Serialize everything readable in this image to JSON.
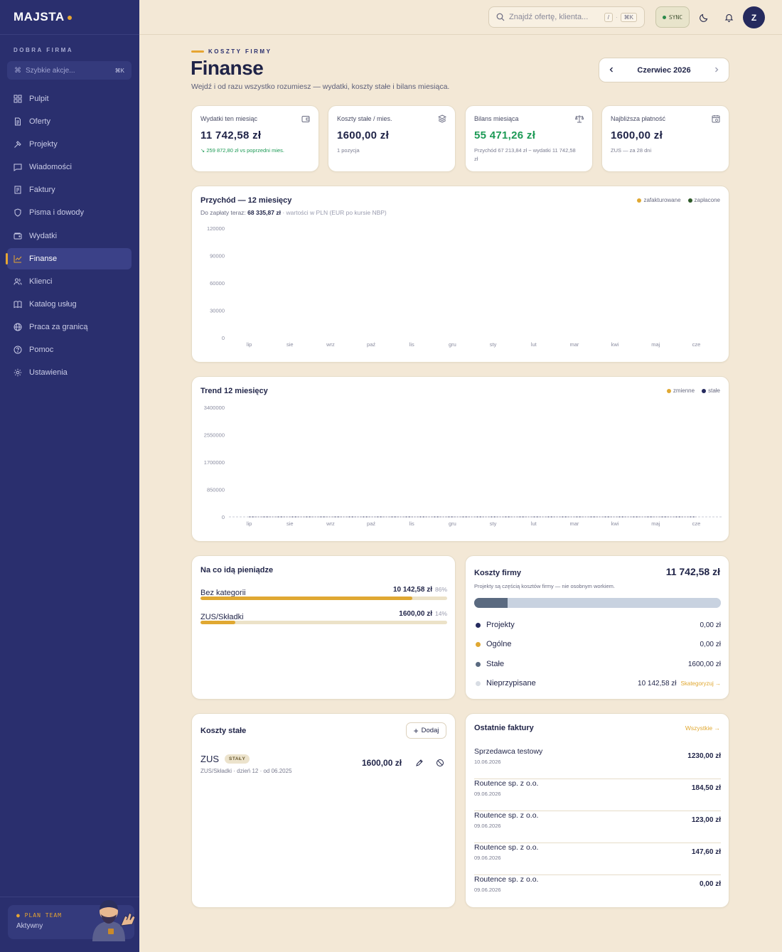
{
  "app": {
    "logo": "MAJSTA"
  },
  "sidebar": {
    "org_label": "DOBRA FIRMA",
    "quick_actions": {
      "label": "Szybkie akcje...",
      "shortcut": "⌘K"
    },
    "items": [
      {
        "label": "Pulpit",
        "icon": "dashboard-icon",
        "active": false
      },
      {
        "label": "Oferty",
        "icon": "document-icon",
        "active": false
      },
      {
        "label": "Projekty",
        "icon": "hammer-icon",
        "active": false
      },
      {
        "label": "Wiadomości",
        "icon": "message-icon",
        "active": false
      },
      {
        "label": "Faktury",
        "icon": "invoice-icon",
        "active": false
      },
      {
        "label": "Pisma i dowody",
        "icon": "shield-icon",
        "active": false
      },
      {
        "label": "Wydatki",
        "icon": "wallet-icon",
        "active": false
      },
      {
        "label": "Finanse",
        "icon": "chart-line-icon",
        "active": true
      },
      {
        "label": "Klienci",
        "icon": "users-icon",
        "active": false
      },
      {
        "label": "Katalog usług",
        "icon": "book-icon",
        "active": false
      },
      {
        "label": "Praca za granicą",
        "icon": "globe-icon",
        "active": false
      },
      {
        "label": "Pomoc",
        "icon": "help-icon",
        "active": false
      },
      {
        "label": "Ustawienia",
        "icon": "gear-icon",
        "active": false
      }
    ],
    "plan": {
      "title": "PLAN TEAM",
      "status": "Aktywny"
    }
  },
  "topbar": {
    "search_placeholder": "Znajdź ofertę, klienta...",
    "search_key1": "/",
    "search_sep": "·",
    "search_key2": "⌘K",
    "sync_label": "SYNC",
    "avatar_initial": "Z"
  },
  "header": {
    "eyebrow": "KOSZTY FIRMY",
    "title": "Finanse",
    "subtitle": "Wejdź i od razu wszystko rozumiesz — wydatki, koszty stałe i bilans miesiąca.",
    "month": "Czerwiec 2026"
  },
  "stats": [
    {
      "label": "Wydatki ten miesiąc",
      "value": "11 742,58 zł",
      "sub": "↘ 259 872,80 zł vs poprzedni mies.",
      "icon": "wallet-icon",
      "green_value": false,
      "green_sub": true
    },
    {
      "label": "Koszty stałe / mies.",
      "value": "1600,00 zł",
      "sub": "1 pozycja",
      "icon": "layers-icon",
      "green_value": false,
      "green_sub": false
    },
    {
      "label": "Bilans miesiąca",
      "value": "55 471,26 zł",
      "sub": "Przychód 67 213,84 zł − wydatki 11 742,58 zł",
      "icon": "scale-icon",
      "green_value": true,
      "green_sub": false
    },
    {
      "label": "Najbliższa płatność",
      "value": "1600,00 zł",
      "sub": "ZUS — za 28 dni",
      "icon": "calendar-icon",
      "green_value": false,
      "green_sub": false
    }
  ],
  "revenue_chart": {
    "title": "Przychód — 12 miesięcy",
    "sub_prefix": "Do zapłaty teraz:",
    "sub_value": "68 335,87 zł",
    "sub_note": "· wartości w PLN (EUR po kursie NBP)",
    "legend": [
      {
        "name": "zafakturowane",
        "color": "#e0a832"
      },
      {
        "name": "zapłacone",
        "color": "#2f5a2a"
      }
    ]
  },
  "trend_chart": {
    "title": "Trend 12 miesięcy",
    "legend": [
      {
        "name": "zmienne",
        "color": "#e0a832"
      },
      {
        "name": "stałe",
        "color": "#252a5e"
      }
    ]
  },
  "chart_data": [
    {
      "type": "bar",
      "title": "Przychód — 12 miesięcy",
      "categories": [
        "lip",
        "sie",
        "wrz",
        "paź",
        "lis",
        "gru",
        "sty",
        "lut",
        "mar",
        "kwi",
        "maj",
        "cze"
      ],
      "yticks": [
        120000,
        90000,
        60000,
        30000,
        0
      ],
      "ylim": [
        0,
        120000
      ],
      "series": [
        {
          "name": "zafakturowane",
          "values": [
            0,
            0,
            0,
            0,
            0,
            0,
            0,
            0,
            0,
            0,
            0,
            0
          ]
        },
        {
          "name": "zapłacone",
          "values": [
            0,
            0,
            0,
            0,
            0,
            0,
            0,
            0,
            0,
            0,
            0,
            0
          ]
        }
      ]
    },
    {
      "type": "area",
      "title": "Trend 12 miesięcy",
      "categories": [
        "lip",
        "sie",
        "wrz",
        "paź",
        "lis",
        "gru",
        "sty",
        "lut",
        "mar",
        "kwi",
        "maj",
        "cze"
      ],
      "yticks": [
        3400000,
        2550000,
        1700000,
        850000,
        0
      ],
      "ylim": [
        0,
        3400000
      ],
      "series": [
        {
          "name": "zmienne",
          "values": [
            0,
            0,
            0,
            0,
            0,
            0,
            0,
            0,
            0,
            0,
            0,
            0
          ]
        },
        {
          "name": "stałe",
          "values": [
            0,
            0,
            0,
            0,
            0,
            0,
            0,
            0,
            0,
            0,
            0,
            0
          ]
        }
      ]
    }
  ],
  "spending": {
    "title": "Na co idą pieniądze",
    "rows": [
      {
        "name": "Bez kategorii",
        "value": "10 142,58 zł",
        "pct": "86%",
        "fraction": 0.86
      },
      {
        "name": "ZUS/Składki",
        "value": "1600,00 zł",
        "pct": "14%",
        "fraction": 0.14
      }
    ]
  },
  "company_costs": {
    "title": "Koszty firmy",
    "total": "11 742,58 zł",
    "sub": "Projekty są częścią kosztów firmy — nie osobnym workiem.",
    "segments": [
      {
        "name": "Projekty",
        "value": "0,00 zł",
        "color": "#252a5e",
        "fraction": 0
      },
      {
        "name": "Ogólne",
        "value": "0,00 zł",
        "color": "#e0a832",
        "fraction": 0
      },
      {
        "name": "Stałe",
        "value": "1600,00 zł",
        "color": "#5a6a80",
        "fraction": 0.136
      },
      {
        "name": "Nieprzypisane",
        "value": "10 142,58 zł",
        "color": "#c8d2e0",
        "fraction": 0.864,
        "link": "Skategoryzuj →"
      }
    ]
  },
  "fixed_costs": {
    "title": "Koszty stałe",
    "add_label": "Dodaj",
    "item": {
      "name": "ZUS",
      "badge": "STAŁY",
      "sub": "ZUS/Składki · dzień 12 · od 06.2025",
      "value": "1600,00 zł"
    }
  },
  "invoices": {
    "title": "Ostatnie faktury",
    "all_link": "Wszystkie →",
    "rows": [
      {
        "name": "Sprzedawca testowy",
        "date": "10.06.2026",
        "value": "1230,00 zł"
      },
      {
        "name": "Routence sp. z o.o.",
        "date": "09.06.2026",
        "value": "184,50 zł"
      },
      {
        "name": "Routence sp. z o.o.",
        "date": "09.06.2026",
        "value": "123,00 zł"
      },
      {
        "name": "Routence sp. z o.o.",
        "date": "09.06.2026",
        "value": "147,60 zł"
      },
      {
        "name": "Routence sp. z o.o.",
        "date": "09.06.2026",
        "value": "0,00 zł"
      }
    ]
  }
}
